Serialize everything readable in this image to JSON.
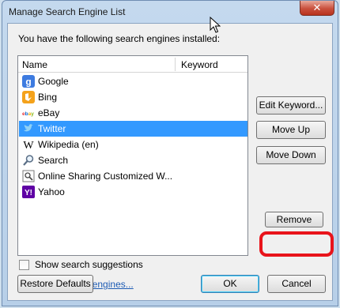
{
  "window": {
    "title": "Manage Search Engine List",
    "close_label": "✕"
  },
  "intro_text": "You have the following search engines installed:",
  "list": {
    "columns": {
      "name": "Name",
      "keyword": "Keyword"
    },
    "engines": [
      {
        "name": "Google",
        "keyword": "",
        "icon": "google-icon"
      },
      {
        "name": "Bing",
        "keyword": "",
        "icon": "bing-icon"
      },
      {
        "name": "eBay",
        "keyword": "",
        "icon": "ebay-icon"
      },
      {
        "name": "Twitter",
        "keyword": "",
        "icon": "twitter-icon",
        "selected": true
      },
      {
        "name": "Wikipedia (en)",
        "keyword": "",
        "icon": "wikipedia-icon"
      },
      {
        "name": "Search",
        "keyword": "",
        "icon": "magnifier-icon"
      },
      {
        "name": "Online Sharing Customized W...",
        "keyword": "",
        "icon": "search-page-icon"
      },
      {
        "name": "Yahoo",
        "keyword": "",
        "icon": "yahoo-icon"
      }
    ]
  },
  "buttons": {
    "edit_keyword": "Edit Keyword...",
    "move_up": "Move Up",
    "move_down": "Move Down",
    "remove": "Remove",
    "restore_defaults": "Restore Defaults",
    "ok": "OK",
    "cancel": "Cancel"
  },
  "options": {
    "show_suggestions": "Show search suggestions",
    "show_suggestions_checked": false
  },
  "link_text": "Get more search engines...",
  "colors": {
    "selection": "#3399ff",
    "highlight_ring": "#e8141b",
    "link": "#1d5bb4"
  }
}
